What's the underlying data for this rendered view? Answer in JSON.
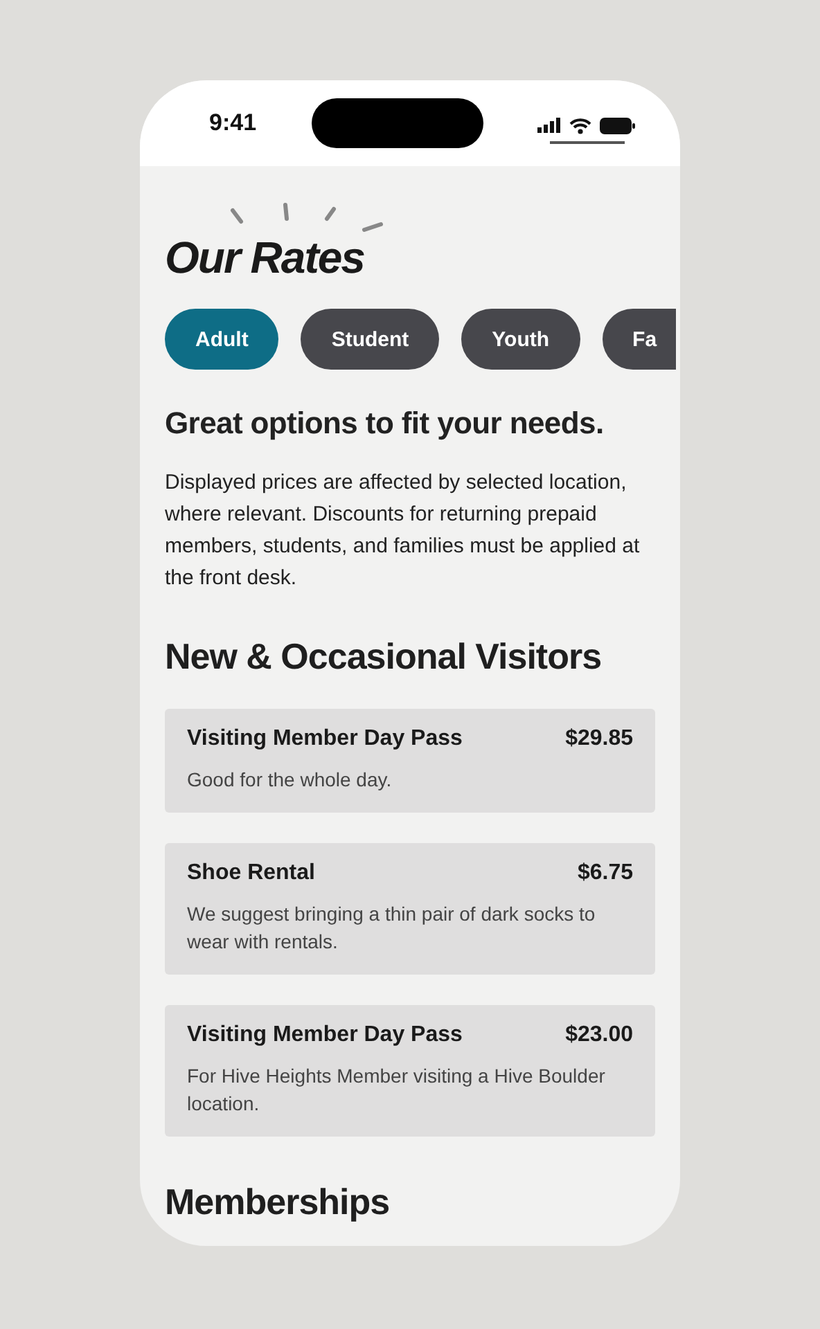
{
  "status_bar": {
    "time": "9:41"
  },
  "title": "Our Rates",
  "tabs": [
    {
      "label": "Adult",
      "selected": true
    },
    {
      "label": "Student",
      "selected": false
    },
    {
      "label": "Youth",
      "selected": false
    },
    {
      "label": "Fa",
      "selected": false
    }
  ],
  "subtitle": "Great options to fit your needs.",
  "intro": "Displayed prices are affected by selected location, where relevant. Discounts for returning prepaid members, students, and families must be applied at the front desk.",
  "sections": [
    {
      "heading": "New & Occasional Visitors",
      "rates": [
        {
          "name": "Visiting Member Day Pass",
          "price": "$29.85",
          "description": "Good for the whole day."
        },
        {
          "name": "Shoe Rental",
          "price": "$6.75",
          "description": "We suggest bringing a thin pair of dark socks to wear with rentals."
        },
        {
          "name": "Visiting Member Day Pass",
          "price": "$23.00",
          "description": "For Hive Heights Member visiting a Hive Boulder location."
        }
      ]
    },
    {
      "heading": "Memberships"
    }
  ]
}
